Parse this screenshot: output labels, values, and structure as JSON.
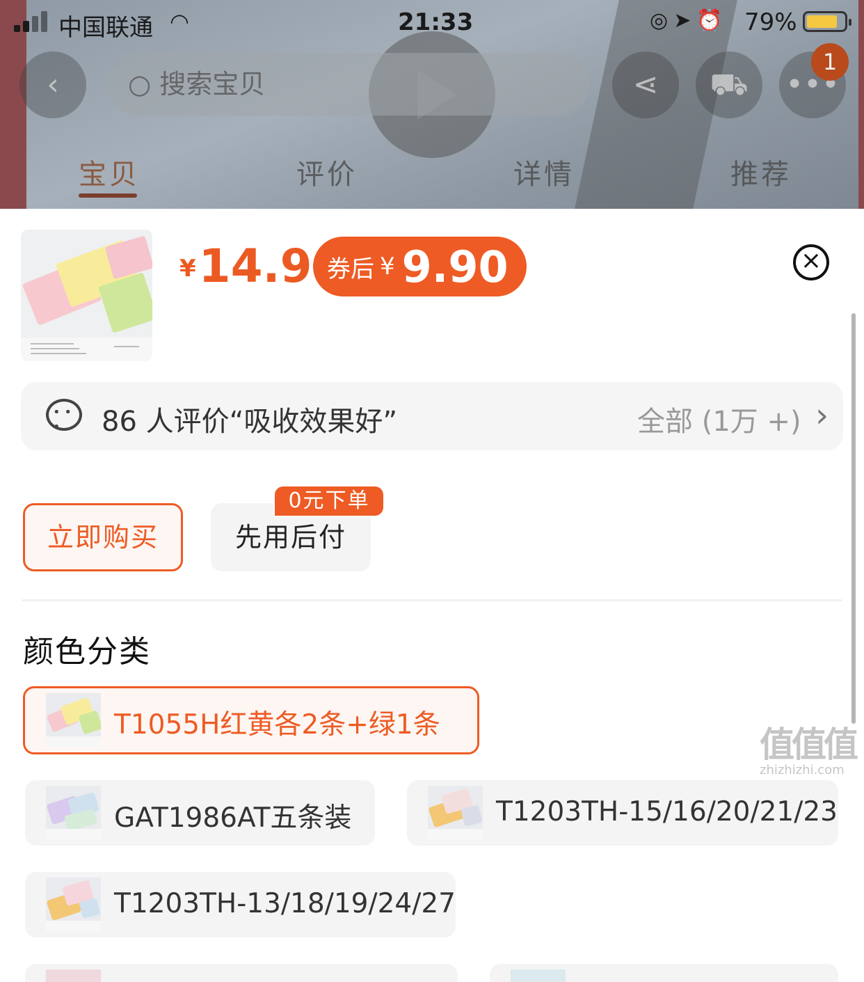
{
  "status_bar": {
    "carrier": "中国联通",
    "time": "21:33",
    "battery_percent": "79%",
    "battery_level": 0.79
  },
  "background_page": {
    "search_placeholder": "搜索宝贝",
    "cart_count": "1",
    "tabs": [
      {
        "label": "宝贝",
        "active": true
      },
      {
        "label": "评价",
        "active": false
      },
      {
        "label": "详情",
        "active": false
      },
      {
        "label": "推荐",
        "active": false
      }
    ]
  },
  "sheet": {
    "price": {
      "currency": "¥",
      "value": "14.9"
    },
    "coupon": {
      "label": "券后",
      "currency": "¥",
      "value": "9.90"
    },
    "reviews": {
      "summary": "86 人评价“吸收效果好”",
      "all_label": "全部 (1万 +)"
    },
    "buttons": {
      "buy_now": "立即购买",
      "pay_later": "先用后付",
      "pay_later_badge": "0元下单"
    },
    "option_group_title": "颜色分类",
    "options": [
      {
        "label": "T1055H红黄各2条+绿1条",
        "selected": true
      },
      {
        "label": "GAT1986AT五条装",
        "selected": false
      },
      {
        "label": "T1203TH-15/16/20/21/23",
        "selected": false
      },
      {
        "label": "T1203TH-13/18/19/24/27",
        "selected": false
      }
    ]
  },
  "watermark": {
    "logo": "值值值",
    "site": "zhizhizhi.com"
  },
  "colors": {
    "accent": "#ee5b24",
    "price": "#ec5a23"
  }
}
